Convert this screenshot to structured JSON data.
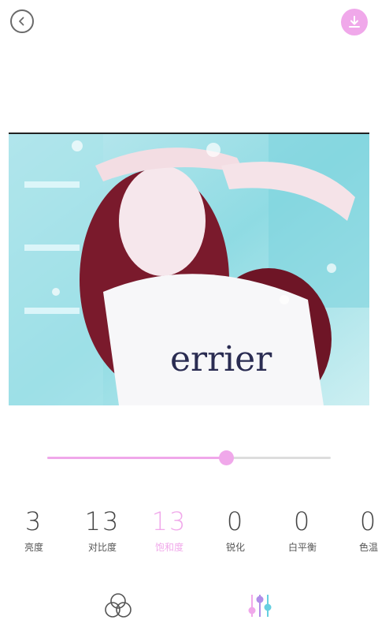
{
  "colors": {
    "accent": "#f0a8ea",
    "text": "#444444",
    "muted": "#555555",
    "track": "#dddddd"
  },
  "icons": {
    "back": "chevron-left-icon",
    "download": "download-icon",
    "filter_tab": "circles-filter-icon",
    "adjust_tab": "sliders-icon"
  },
  "slider": {
    "value_percent": 63
  },
  "adjustments": [
    {
      "value": "3",
      "label": "亮度",
      "active": false
    },
    {
      "value": "13",
      "label": "对比度",
      "active": false
    },
    {
      "value": "13",
      "label": "饱和度",
      "active": true
    },
    {
      "value": "0",
      "label": "锐化",
      "active": false
    },
    {
      "value": "0",
      "label": "白平衡",
      "active": false
    },
    {
      "value": "0",
      "label": "色温",
      "active": false
    }
  ]
}
